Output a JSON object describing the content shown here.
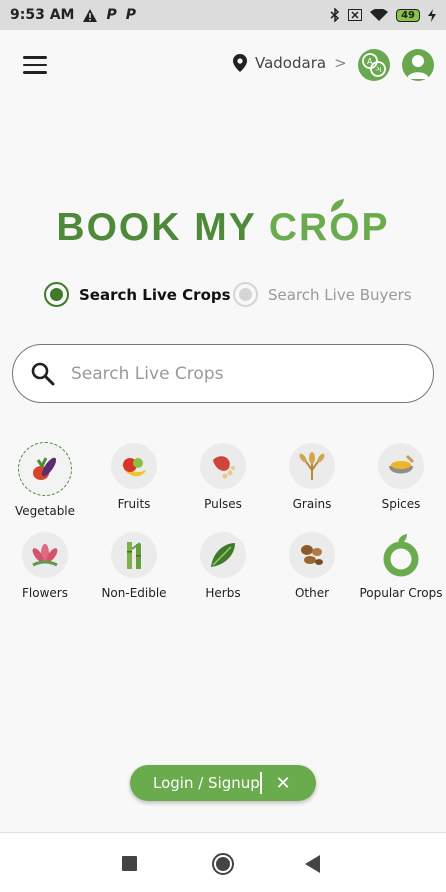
{
  "status_bar": {
    "time": "9:53 AM",
    "battery": "49",
    "icons": [
      "alert-icon",
      "parking-icon",
      "parking-icon",
      "bluetooth-icon",
      "sim-icon",
      "wifi-icon",
      "battery-icon",
      "charging-icon"
    ]
  },
  "header": {
    "location": "Vadodara",
    "location_chevron": ">",
    "language_icon": "language-icon",
    "profile_icon": "profile-icon"
  },
  "logo": {
    "word1": "BOOK MY",
    "word2": "CROP"
  },
  "search_mode": {
    "options": [
      {
        "label": "Search Live Crops",
        "selected": true
      },
      {
        "label": "Search Live Buyers",
        "selected": false
      }
    ]
  },
  "search": {
    "placeholder": "Search Live Crops"
  },
  "categories": [
    {
      "label": "Vegetable",
      "icon": "vegetable-icon",
      "selected": true
    },
    {
      "label": "Fruits",
      "icon": "fruits-icon"
    },
    {
      "label": "Pulses",
      "icon": "pulses-icon"
    },
    {
      "label": "Grains",
      "icon": "grains-icon"
    },
    {
      "label": "Spices",
      "icon": "spices-icon"
    },
    {
      "label": "Flowers",
      "icon": "flowers-icon"
    },
    {
      "label": "Non-Edible",
      "icon": "non-edible-icon"
    },
    {
      "label": "Herbs",
      "icon": "herbs-icon"
    },
    {
      "label": "Other",
      "icon": "other-icon"
    },
    {
      "label": "Popular Crops",
      "icon": "popular-crops-icon"
    }
  ],
  "login_bar": {
    "label": "Login / Signup",
    "close": "✕"
  },
  "colors": {
    "primary": "#6aab4d",
    "dark_green": "#3f7a2b",
    "background": "#f8f8f8"
  }
}
